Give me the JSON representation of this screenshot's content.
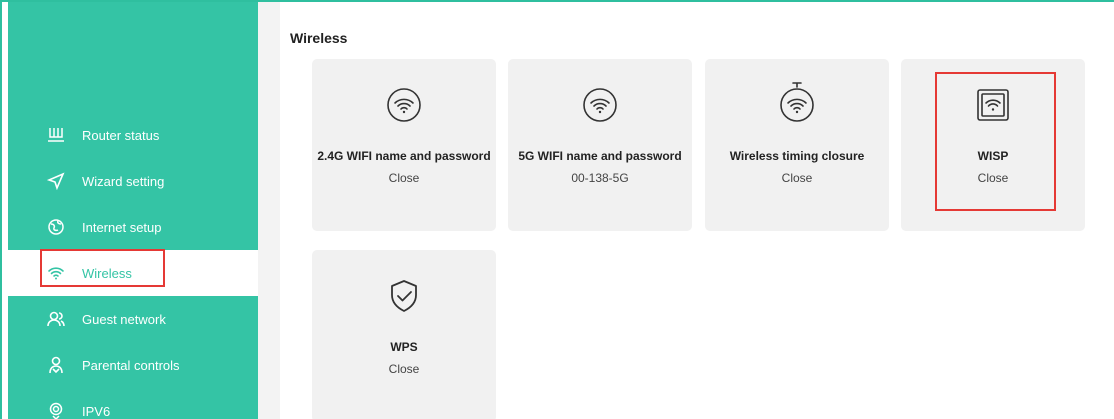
{
  "sidebar": {
    "items": [
      {
        "label": "Router status",
        "icon": "router-icon",
        "active": false
      },
      {
        "label": "Wizard setting",
        "icon": "wizard-icon",
        "active": false
      },
      {
        "label": "Internet setup",
        "icon": "globe-icon",
        "active": false
      },
      {
        "label": "Wireless",
        "icon": "wifi-icon",
        "active": true
      },
      {
        "label": "Guest network",
        "icon": "guests-icon",
        "active": false
      },
      {
        "label": "Parental controls",
        "icon": "parental-icon",
        "active": false
      },
      {
        "label": "IPV6",
        "icon": "ipv6-icon",
        "active": false
      }
    ]
  },
  "main": {
    "title": "Wireless",
    "cards": [
      {
        "title": "2.4G WIFI name and password",
        "value": "Close",
        "icon": "wifi-icon"
      },
      {
        "title": "5G WIFI name and password",
        "value": "00-138-5G",
        "icon": "wifi-icon"
      },
      {
        "title": "Wireless timing closure",
        "value": "Close",
        "icon": "wifi-timer-icon"
      },
      {
        "title": "WISP",
        "value": "Close",
        "icon": "wisp-icon"
      },
      {
        "title": "WPS",
        "value": "Close",
        "icon": "shield-check-icon"
      }
    ]
  },
  "colors": {
    "accent": "#34c4a5",
    "highlight": "#e53935",
    "card_bg": "#f1f1f1"
  }
}
